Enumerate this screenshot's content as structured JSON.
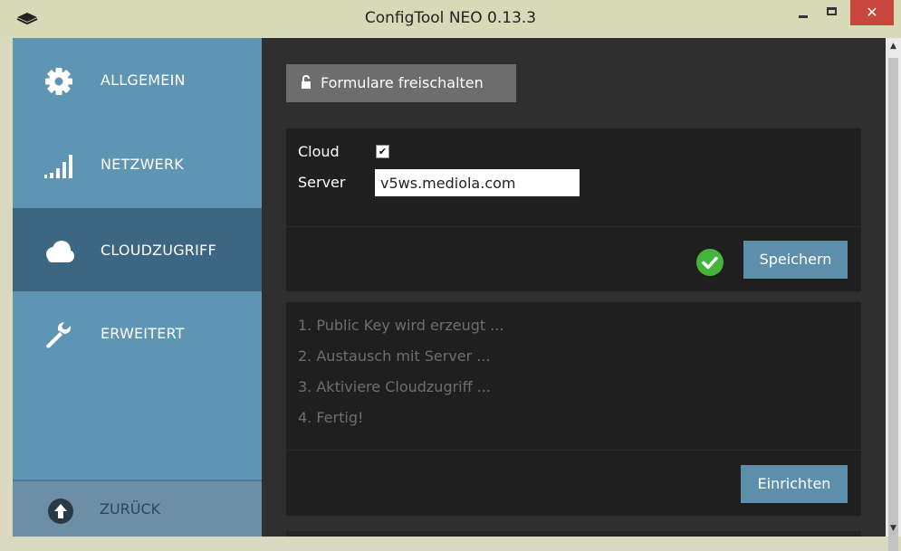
{
  "window": {
    "title": "ConfigTool NEO 0.13.3",
    "close_glyph": "✕"
  },
  "sidebar": {
    "items": [
      {
        "label": "ALLGEMEIN",
        "icon": "gear-icon",
        "active": false
      },
      {
        "label": "NETZWERK",
        "icon": "signal-bars-icon",
        "active": false
      },
      {
        "label": "CLOUDZUGRIFF",
        "icon": "cloud-icon",
        "active": true
      },
      {
        "label": "ERWEITERT",
        "icon": "wrench-icon",
        "active": false
      }
    ],
    "back": {
      "label": "ZURÜCK",
      "icon": "arrow-up-circle-icon"
    }
  },
  "main": {
    "unlock_label": "Formulare freischalten",
    "cloud_label": "Cloud",
    "cloud_checked": true,
    "checkbox_glyph": "✔",
    "server_label": "Server",
    "server_value": "v5ws.mediola.com",
    "save_label": "Speichern",
    "save_status": "success",
    "steps": [
      "1. Public Key wird erzeugt ...",
      "2. Austausch mit Server ...",
      "3. Aktiviere Cloudzugriff ...",
      "4. Fertig!"
    ],
    "setup_label": "Einrichten"
  },
  "scrollbar": {
    "up_glyph": "▲",
    "down_glyph": "▼"
  },
  "colors": {
    "sidebar": "#5e95b3",
    "sidebar_active": "#3c6681",
    "content_bg": "#2f2f2f",
    "panel_bg": "#1f1f1f",
    "button_blue": "#5d8faa",
    "success_green": "#44b43a",
    "close_red": "#c9463d"
  }
}
